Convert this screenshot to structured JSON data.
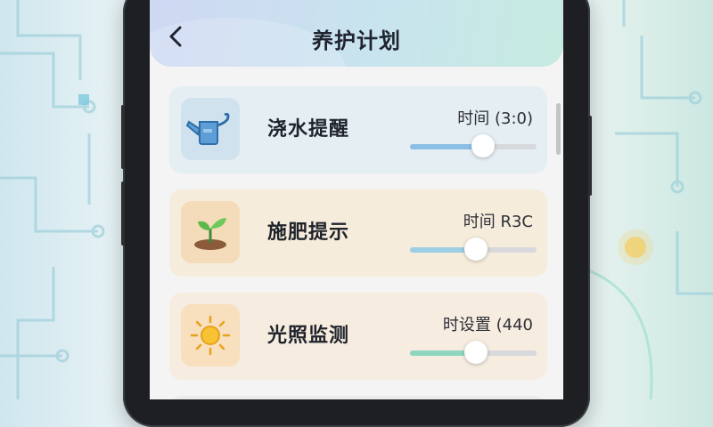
{
  "header": {
    "title": "养护计划",
    "back_icon": "chevron-left-icon"
  },
  "cards": [
    {
      "label": "浇水提醒",
      "meta": "时间 (3:0)",
      "icon": "watering-can-icon",
      "slider_value": 0.58,
      "fill_color": "#8cbfe6"
    },
    {
      "label": "施肥提示",
      "meta": "时间 R3C",
      "icon": "sprout-icon",
      "slider_value": 0.52,
      "fill_color": "#9ccfe3"
    },
    {
      "label": "光照监测",
      "meta": "时设置 (440",
      "icon": "sun-icon",
      "slider_value": 0.52,
      "fill_color": "#8fd6c0"
    }
  ],
  "colors": {
    "accent": "#8cbfe6",
    "header_start": "#cfd8f3",
    "header_end": "#c6ebe0"
  }
}
